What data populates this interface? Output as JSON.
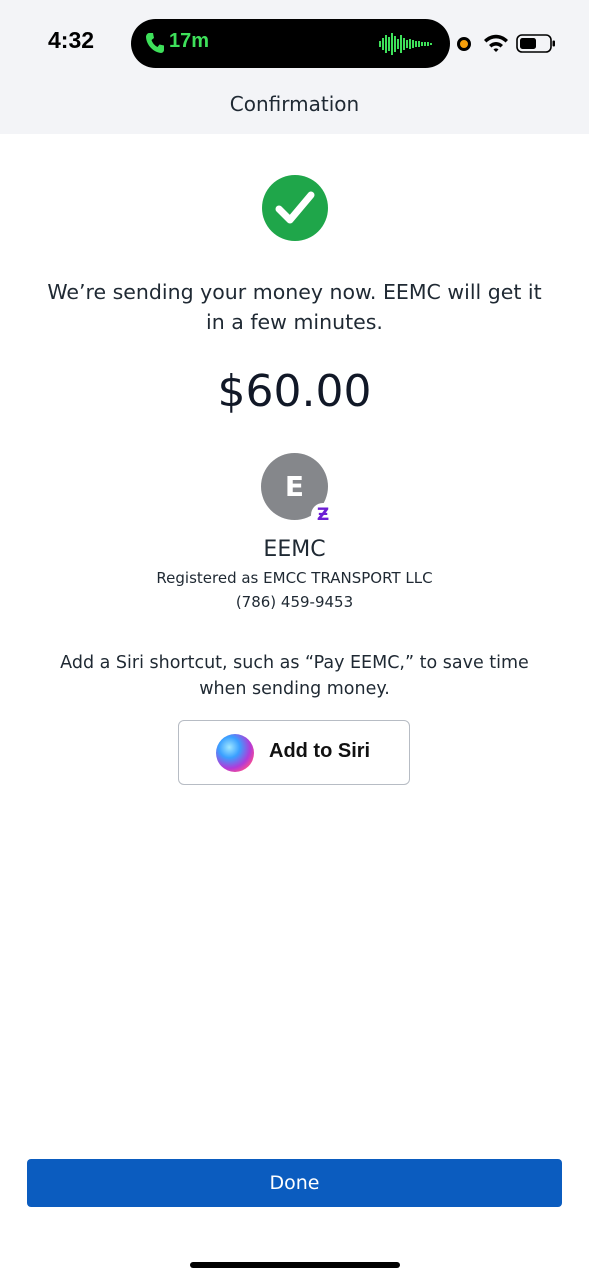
{
  "status_bar": {
    "time": "4:32",
    "call_duration": "17m",
    "icons": [
      "phone-icon",
      "waveform-icon",
      "recording-dot",
      "wifi-icon",
      "battery-icon"
    ],
    "call_color": "#3ee05a",
    "recording_dot_color": "#f59e0b"
  },
  "header": {
    "title": "Confirmation"
  },
  "confirmation": {
    "status_icon": "check-circle-icon",
    "success_color": "#1fa64a",
    "message": "We’re sending your money now. EEMC  will get it in a few minutes.",
    "amount": "$60.00"
  },
  "recipient": {
    "avatar_initial": "E",
    "badge_glyph": "Ƶ",
    "badge_color": "#6d1ed4",
    "name": "EEMC",
    "registered_as": "Registered as EMCC TRANSPORT LLC",
    "phone": "(786) 459-9453"
  },
  "siri": {
    "prompt": "Add a Siri shortcut, such as “Pay EEMC,” to save time when sending money.",
    "button_label": "Add to Siri",
    "icon": "siri-icon"
  },
  "footer": {
    "done_label": "Done",
    "done_color": "#0b5cbf"
  }
}
